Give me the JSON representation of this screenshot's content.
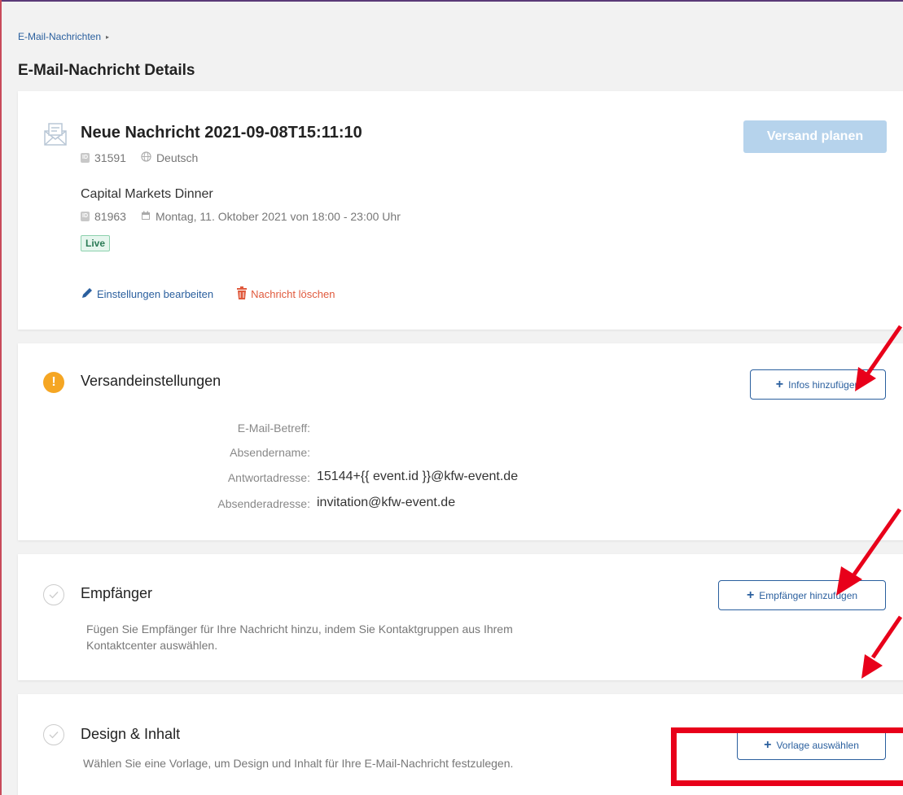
{
  "breadcrumb": {
    "label": "E-Mail-Nachrichten",
    "caret": "▸"
  },
  "page_title": "E-Mail-Nachricht Details",
  "message": {
    "title": "Neue Nachricht 2021-09-08T15:11:10",
    "id_badge": "ID",
    "id": "31591",
    "language": "Deutsch",
    "schedule_button": "Versand planen",
    "event_name": "Capital Markets Dinner",
    "event_id": "81963",
    "event_date": "Montag, 11. Oktober 2021 von 18:00 - 23:00 Uhr",
    "status": "Live",
    "edit_label": "Einstellungen bearbeiten",
    "delete_label": "Nachricht löschen"
  },
  "shipping": {
    "title": "Versandeinstellungen",
    "warning_glyph": "!",
    "add_button": "Infos hinzufügen",
    "fields": [
      {
        "label": "E-Mail-Betreff:",
        "value": ""
      },
      {
        "label": "Absendername:",
        "value": ""
      },
      {
        "label": "Antwortadresse:",
        "value": "15144+{{ event.id }}@kfw-event.de"
      },
      {
        "label": "Absenderadresse:",
        "value": "invitation@kfw-event.de"
      }
    ]
  },
  "recipients": {
    "title": "Empfänger",
    "add_button": "Empfänger hinzufügen",
    "description_line1": "Fügen Sie Empfänger für Ihre Nachricht hinzu, indem Sie Kontaktgruppen aus Ihrem",
    "description_line2": "Kontaktcenter auswählen."
  },
  "design": {
    "title": "Design & Inhalt",
    "add_button": "Vorlage auswählen",
    "description": "Wählen Sie eine Vorlage, um Design und Inhalt für Ihre E-Mail-Nachricht festzulegen."
  },
  "plus_glyph": "+",
  "colors": {
    "primary": "#2a5f9e",
    "danger": "#e05a3d",
    "warning": "#f5a623",
    "live_green": "#2a7a55",
    "annotation_red": "#e8001a",
    "disabled_button": "#b6d3ec"
  }
}
